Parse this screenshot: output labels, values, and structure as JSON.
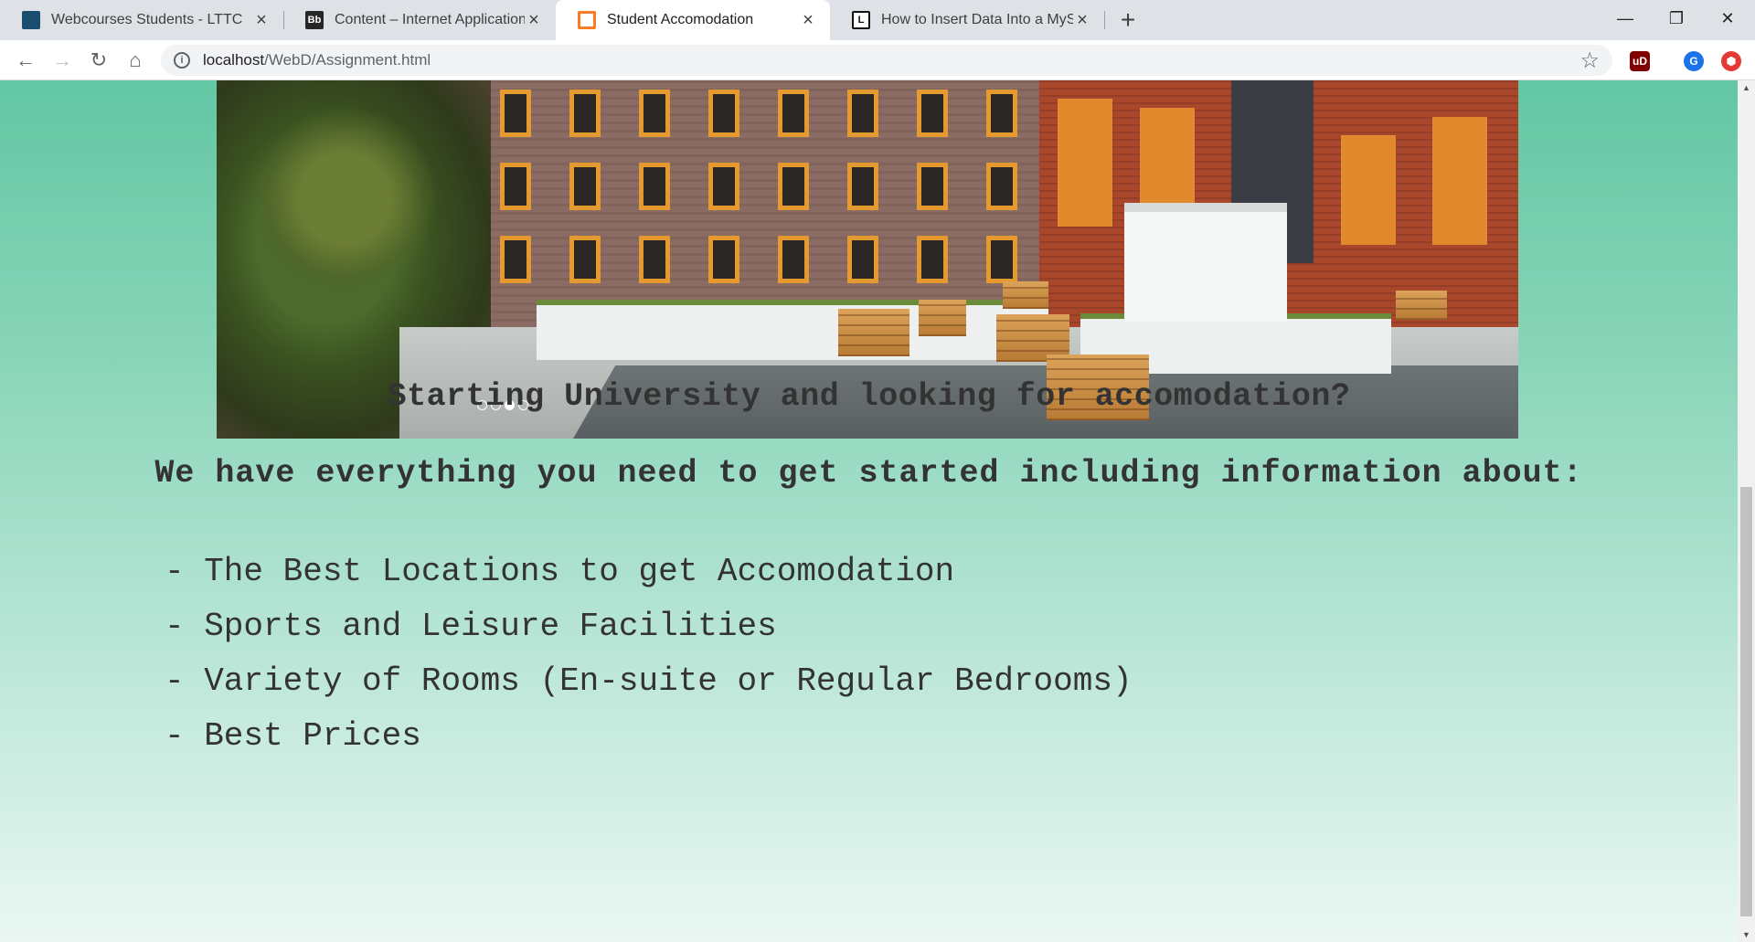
{
  "browser": {
    "tabs": [
      {
        "title": "Webcourses Students - LTTC",
        "favicon": "webcourses-favicon",
        "color": "#1a4d70"
      },
      {
        "title": "Content – Internet Application ar",
        "favicon": "blackboard-favicon",
        "favicon_text": "Bb",
        "color": "#262626"
      },
      {
        "title": "Student Accomodation",
        "favicon": "xampp-favicon",
        "color": "#fb7a24",
        "active": true
      },
      {
        "title": "How to Insert Data Into a MySQL",
        "favicon": "lifewire-favicon",
        "favicon_text": "L",
        "color": "#111111"
      }
    ],
    "new_tab_label": "+",
    "window_controls": {
      "minimize": "—",
      "maximize": "❐",
      "close": "✕"
    },
    "url": {
      "host": "localhost",
      "path": "/WebD/Assignment.html"
    },
    "extensions": [
      {
        "name": "ublock-origin-icon",
        "text": "uD",
        "color": "#800000"
      },
      {
        "name": "profile-avatar",
        "text": "G",
        "color": "#1a73e8"
      },
      {
        "name": "extension-red-icon",
        "text": "⬢",
        "color": "#e53935"
      }
    ]
  },
  "page": {
    "slideshow": {
      "slide_count": 4,
      "active_index": 2
    },
    "question_heading": "Starting University and looking for accomodation?",
    "intro_heading": "We have everything you need to get started including information about:",
    "features": [
      "- The Best Locations to get Accomodation",
      "- Sports and Leisure Facilities",
      "- Variety of Rooms (En-suite or Regular Bedrooms)",
      "- Best Prices"
    ]
  }
}
